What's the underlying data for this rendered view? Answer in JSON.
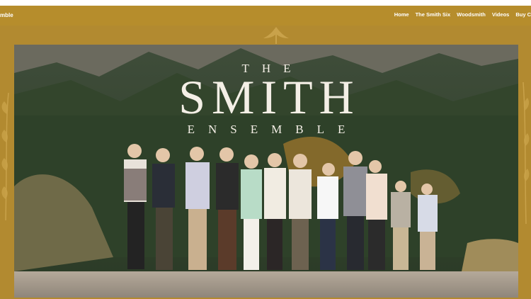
{
  "header": {
    "brand": "mble",
    "nav": [
      "Home",
      "The Smith Six",
      "Woodsmith",
      "Videos",
      "Buy C"
    ]
  },
  "hero": {
    "title_top": "THE",
    "title_main": "SMITH",
    "title_sub": "ENSEMBLE"
  },
  "colors": {
    "brand_gold": "#b68d2c",
    "frame_gold": "#b28a30",
    "title_text": "#f4efe6"
  }
}
